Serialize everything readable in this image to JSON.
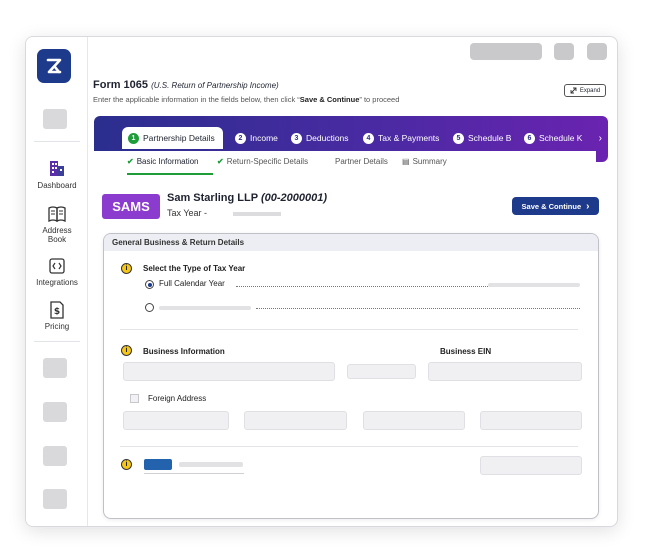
{
  "sidebar": {
    "logo_icon": "z-logo-icon",
    "items": [
      {
        "label": "Dashboard",
        "icon": "dashboard-buildings-icon"
      },
      {
        "label": "Address Book",
        "icon": "book-icon"
      },
      {
        "label": "Integrations",
        "icon": "integrations-icon"
      },
      {
        "label": "Pricing",
        "icon": "dollar-doc-icon"
      }
    ]
  },
  "header": {
    "title": "Form 1065",
    "title_note": "(U.S. Return of Partnership Income)",
    "instructions_prefix": "Enter the applicable information in the fields below, then click “",
    "instructions_bold": "Save & Continue",
    "instructions_suffix": "” to proceed",
    "expand_label": "Expand"
  },
  "tabs": [
    {
      "num": "1",
      "label": "Partnership Details",
      "active": true
    },
    {
      "num": "2",
      "label": "Income"
    },
    {
      "num": "3",
      "label": "Deductions"
    },
    {
      "num": "4",
      "label": "Tax & Payments"
    },
    {
      "num": "5",
      "label": "Schedule B"
    },
    {
      "num": "6",
      "label": "Schedule K"
    }
  ],
  "subtabs": [
    {
      "label": "Basic Information",
      "done": true,
      "active": true
    },
    {
      "label": "Return-Specific Details",
      "done": true
    },
    {
      "label": "Partner Details"
    },
    {
      "label": "Summary"
    }
  ],
  "company": {
    "avatar": "SAMS",
    "name": "Sam Starling LLP",
    "ein": "(00-2000001)",
    "tax_year_label": "Tax Year -"
  },
  "save_button": "Save & Continue",
  "card": {
    "title": "General Business & Return Details",
    "tax_year_section": "Select the Type of Tax Year",
    "option_full": "Full Calendar Year",
    "business_info": "Business Information",
    "business_ein": "Business EIN",
    "foreign_address": "Foreign Address"
  },
  "colors": {
    "accent": "#1e3a8a",
    "tab_gradient_start": "#2b2e8e",
    "tab_gradient_end": "#6a23b0",
    "avatar": "#8b3ccf",
    "success": "#1f9d3b",
    "info": "#f5c518"
  }
}
